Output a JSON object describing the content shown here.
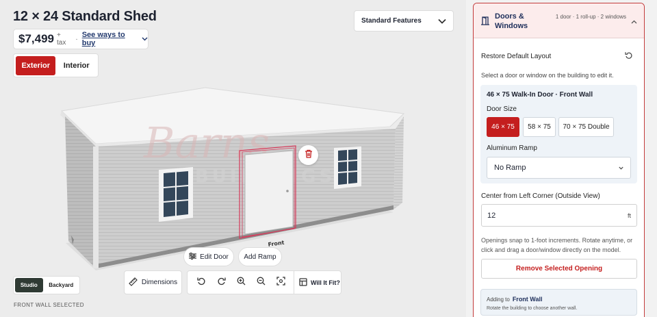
{
  "header": {
    "title": "12 × 24 Standard Shed",
    "price": "$7,499",
    "tax": "+ tax",
    "separator": "·",
    "ways_to_buy": "See ways to buy",
    "standard_features": "Standard Features"
  },
  "view_toggle": {
    "exterior": "Exterior",
    "interior": "Interior",
    "active": "Exterior"
  },
  "model": {
    "watermark_top": "Barns",
    "watermark_bottom": "BUILDINGS",
    "front_label": "Front",
    "colors": {
      "accent": "#c41e1e",
      "selection": "#d63a5a",
      "siding": "#cfcfcf",
      "roof": "#f4f4f4"
    }
  },
  "canvas_buttons": {
    "edit_door": "Edit Door",
    "add_ramp": "Add Ramp"
  },
  "scene_toggle": {
    "studio": "Studio",
    "backyard": "Backyard",
    "active": "Studio"
  },
  "toolbar": {
    "dimensions": "Dimensions",
    "will_it_fit": "Will It Fit?"
  },
  "status_text": "FRONT WALL SELECTED",
  "panel": {
    "title": "Doors & Windows",
    "summary": "1 door · 1 roll-up · 2 windows",
    "restore": "Restore Default Layout",
    "hint": "Select a door or window on the building to edit it.",
    "door": {
      "title": "46 × 75 Walk-In Door · Front Wall",
      "size_label": "Door Size",
      "sizes": [
        "46 × 75",
        "58 × 75",
        "70 × 75 Double"
      ],
      "selected_size": "46 × 75",
      "ramp_label": "Aluminum Ramp",
      "ramp_value": "No Ramp"
    },
    "center_label": "Center from Left Corner (Outside View)",
    "center_value": "12",
    "center_unit": "ft",
    "snap_note": "Openings snap to 1-foot increments. Rotate anytime, or click and drag a door/window directly on the model.",
    "remove": "Remove Selected Opening",
    "adding_prefix": "Adding to",
    "adding_wall": "Front Wall",
    "adding_sub": "Rotate the building to choose another wall."
  }
}
